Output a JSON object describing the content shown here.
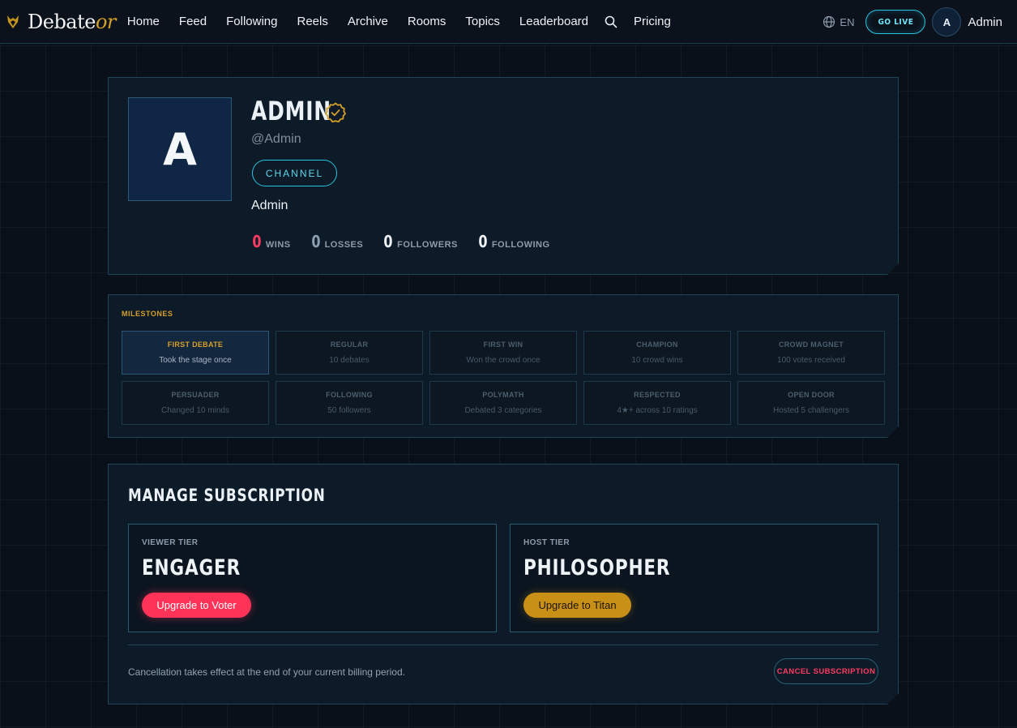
{
  "header": {
    "logo_main": "Debate",
    "logo_accent": "or",
    "nav": [
      "Home",
      "Feed",
      "Following",
      "Reels",
      "Archive",
      "Rooms",
      "Topics",
      "Leaderboard"
    ],
    "pricing": "Pricing",
    "language": "EN",
    "go_live": "GO LIVE",
    "avatar_initial": "A",
    "user_name": "Admin"
  },
  "profile": {
    "avatar_initial": "A",
    "name": "ADMIN",
    "handle": "@Admin",
    "channel_label": "CHANNEL",
    "bio": "Admin",
    "stats": {
      "wins": {
        "value": "0",
        "label": "WINS"
      },
      "losses": {
        "value": "0",
        "label": "LOSSES"
      },
      "followers": {
        "value": "0",
        "label": "FOLLOWERS"
      },
      "following": {
        "value": "0",
        "label": "FOLLOWING"
      }
    }
  },
  "milestones": {
    "title": "MILESTONES",
    "items": [
      {
        "name": "FIRST DEBATE",
        "desc": "Took the stage once",
        "achieved": true
      },
      {
        "name": "REGULAR",
        "desc": "10 debates",
        "achieved": false
      },
      {
        "name": "FIRST WIN",
        "desc": "Won the crowd once",
        "achieved": false
      },
      {
        "name": "CHAMPION",
        "desc": "10 crowd wins",
        "achieved": false
      },
      {
        "name": "CROWD MAGNET",
        "desc": "100 votes received",
        "achieved": false
      },
      {
        "name": "PERSUADER",
        "desc": "Changed 10 minds",
        "achieved": false
      },
      {
        "name": "FOLLOWING",
        "desc": "50 followers",
        "achieved": false
      },
      {
        "name": "POLYMATH",
        "desc": "Debated 3 categories",
        "achieved": false
      },
      {
        "name": "RESPECTED",
        "desc": "4★+ across 10 ratings",
        "achieved": false
      },
      {
        "name": "OPEN DOOR",
        "desc": "Hosted 5 challengers",
        "achieved": false
      }
    ]
  },
  "subscription": {
    "title": "MANAGE SUBSCRIPTION",
    "viewer": {
      "label": "VIEWER TIER",
      "tier": "ENGAGER",
      "button": "Upgrade to Voter"
    },
    "host": {
      "label": "HOST TIER",
      "tier": "PHILOSOPHER",
      "button": "Upgrade to Titan"
    },
    "cancel_note": "Cancellation takes effect at the end of your current billing period.",
    "cancel_button": "CANCEL SUBSCRIPTION"
  },
  "colors": {
    "accent_cyan": "#26c5de",
    "accent_gold": "#d4a02a",
    "accent_red": "#ff3358"
  }
}
